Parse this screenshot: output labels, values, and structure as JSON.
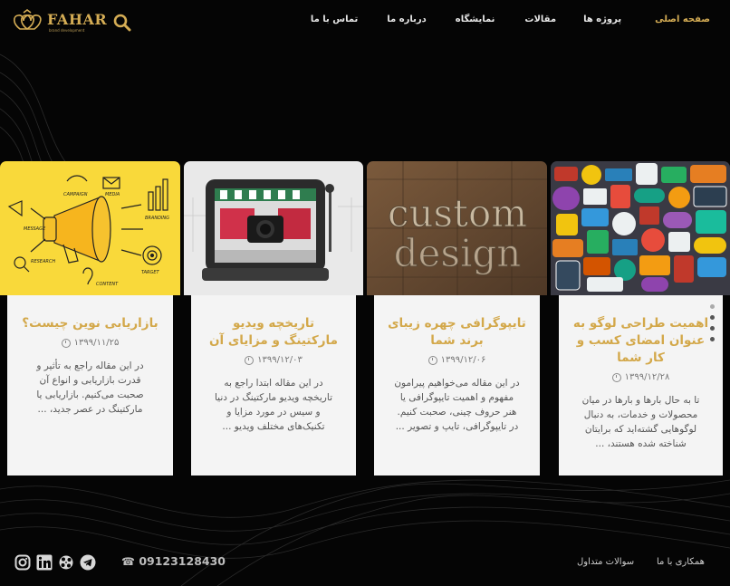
{
  "brand": {
    "name": "FAHAR",
    "tagline": "brand development",
    "color": "#d5ad55"
  },
  "nav": {
    "items": [
      {
        "label": "صفحه اصلی",
        "active": true
      },
      {
        "label": "پروژه ها"
      },
      {
        "label": "مقالات"
      },
      {
        "label": "نمایشگاه"
      },
      {
        "label": "درباره ما"
      },
      {
        "label": "تماس با ما"
      }
    ],
    "search_icon": "search-icon"
  },
  "cards": [
    {
      "title": "اهمیت طراحی لوگو به عنوان امضای کسب و کار شما",
      "date": "۱۳۹۹/۱۲/۲۸",
      "excerpt": "تا به حال بارها و بارها در میان محصولات و خدمات، به دنبال لوگوهایی گشته‌اید که برایتان شناخته شده هستند، ...",
      "image": "sticker-collage"
    },
    {
      "title": "تایپوگرافی چهره زیبای برند شما",
      "date": "۱۳۹۹/۱۲/۰۶",
      "excerpt": "در این مقاله می‌خواهیم پیرامون مفهوم و اهمیت تایپوگرافی یا هنر حروف چینی، صحبت کنیم. در تایپوگرافی، تایپ و تصویر ...",
      "image": "custom-design-letterpress",
      "image_text": [
        "custom",
        "design"
      ]
    },
    {
      "title": "تاریخچه ویدیو مارکتینگ و مزایای آن",
      "date": "۱۳۹۹/۱۲/۰۳",
      "excerpt": "در این مقاله ابتدا راجع به تاریخچه ویدیو مارکتینگ در دنیا و سیس در مورد مزایا و تکنیک‌های مختلف ویدیو ...",
      "image": "video-marketing-tablet"
    },
    {
      "title": "بازاریابی نوین چیست؟",
      "date": "۱۳۹۹/۱۱/۲۵",
      "excerpt": "در این مقاله راجع به تأثیر و قدرت بازاریابی و انواع آن صحبت می‌کنیم. بازاریابی یا مارکتینگ در عصر جدید، ...",
      "image": "megaphone-marketing-doodle",
      "image_labels": [
        "MESSAGE",
        "RESEARCH",
        "CONTENT",
        "TARGET",
        "CAMPAIGN",
        "BRANDING",
        "MEDIA"
      ]
    }
  ],
  "slider": {
    "dot_count": 4,
    "active_index": 0
  },
  "footer": {
    "phone": "09123128430",
    "links": [
      "همکاری با ما",
      "سوالات متداول"
    ],
    "social": [
      "instagram-icon",
      "linkedin-icon",
      "aparat-icon",
      "telegram-icon"
    ]
  }
}
